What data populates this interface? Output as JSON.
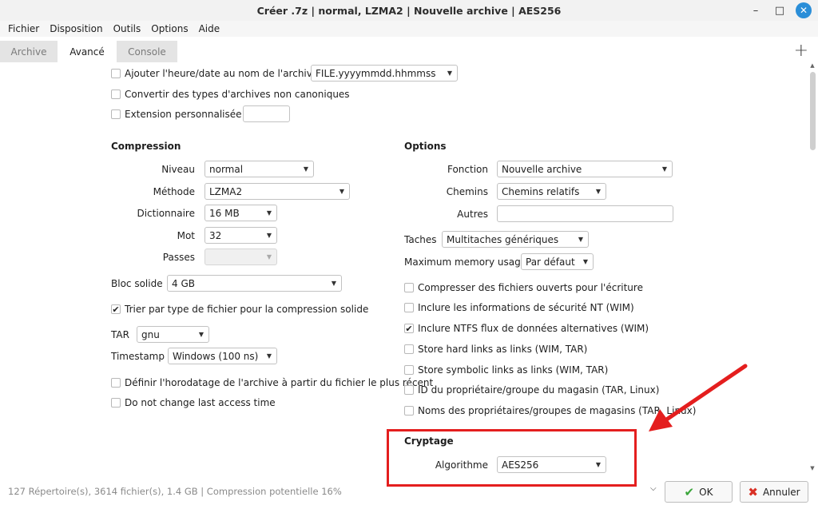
{
  "window": {
    "title": "Créer .7z | normal, LZMA2 | Nouvelle archive | AES256"
  },
  "menu": [
    "Fichier",
    "Disposition",
    "Outils",
    "Options",
    "Aide"
  ],
  "tabs": {
    "archive": "Archive",
    "avance": "Avancé",
    "console": "Console",
    "plus": "+"
  },
  "top": {
    "timestamp_label": "Ajouter l'heure/date au nom de l'archive",
    "timestamp_format": "FILE.yyyymmdd.hhmmss",
    "convert_label": "Convertir des types d'archives non canoniques",
    "custom_ext_label": "Extension personnalisée"
  },
  "compression": {
    "header": "Compression",
    "niveau_label": "Niveau",
    "niveau_value": "normal",
    "methode_label": "Méthode",
    "methode_value": "LZMA2",
    "dict_label": "Dictionnaire",
    "dict_value": "16 MB",
    "mot_label": "Mot",
    "mot_value": "32",
    "passes_label": "Passes",
    "bloc_label": "Bloc solide",
    "bloc_value": "4 GB",
    "sort_label": "Trier par type de fichier pour la compression solide",
    "tar_label": "TAR",
    "tar_value": "gnu",
    "ts_label": "Timestamp",
    "ts_value": "Windows (100 ns)",
    "set_time_label": "Définir l'horodatage de l'archive à partir du fichier le plus récent",
    "no_access_label": "Do not change last access time"
  },
  "options": {
    "header": "Options",
    "fonction_label": "Fonction",
    "fonction_value": "Nouvelle archive",
    "chemins_label": "Chemins",
    "chemins_value": "Chemins relatifs",
    "autres_label": "Autres",
    "taches_label": "Taches",
    "taches_value": "Multitaches génériques",
    "memory_label": "Maximum memory usage",
    "memory_value": "Par défaut",
    "checks": [
      "Compresser des fichiers ouverts pour l'écriture",
      "Inclure les informations de sécurité NT (WIM)",
      "Inclure NTFS flux de données alternatives (WIM)",
      "Store hard links as links (WIM, TAR)",
      "Store symbolic links as links (WIM, TAR)",
      "ID du propriétaire/groupe du magasin (TAR, Linux)",
      "Noms des propriétaires/groupes de magasins (TAR, Linux)"
    ]
  },
  "cryptage": {
    "header": "Cryptage",
    "algo_label": "Algorithme",
    "algo_value": "AES256"
  },
  "status": "127 Répertoire(s), 3614 fichier(s), 1.4 GB | Compression potentielle 16%",
  "buttons": {
    "ok": "OK",
    "cancel": "Annuler"
  },
  "colors": {
    "highlight": "#e41e1e",
    "close_button": "#2a8ed8",
    "ok_check": "#3aa53a",
    "cancel_x": "#d93025"
  }
}
